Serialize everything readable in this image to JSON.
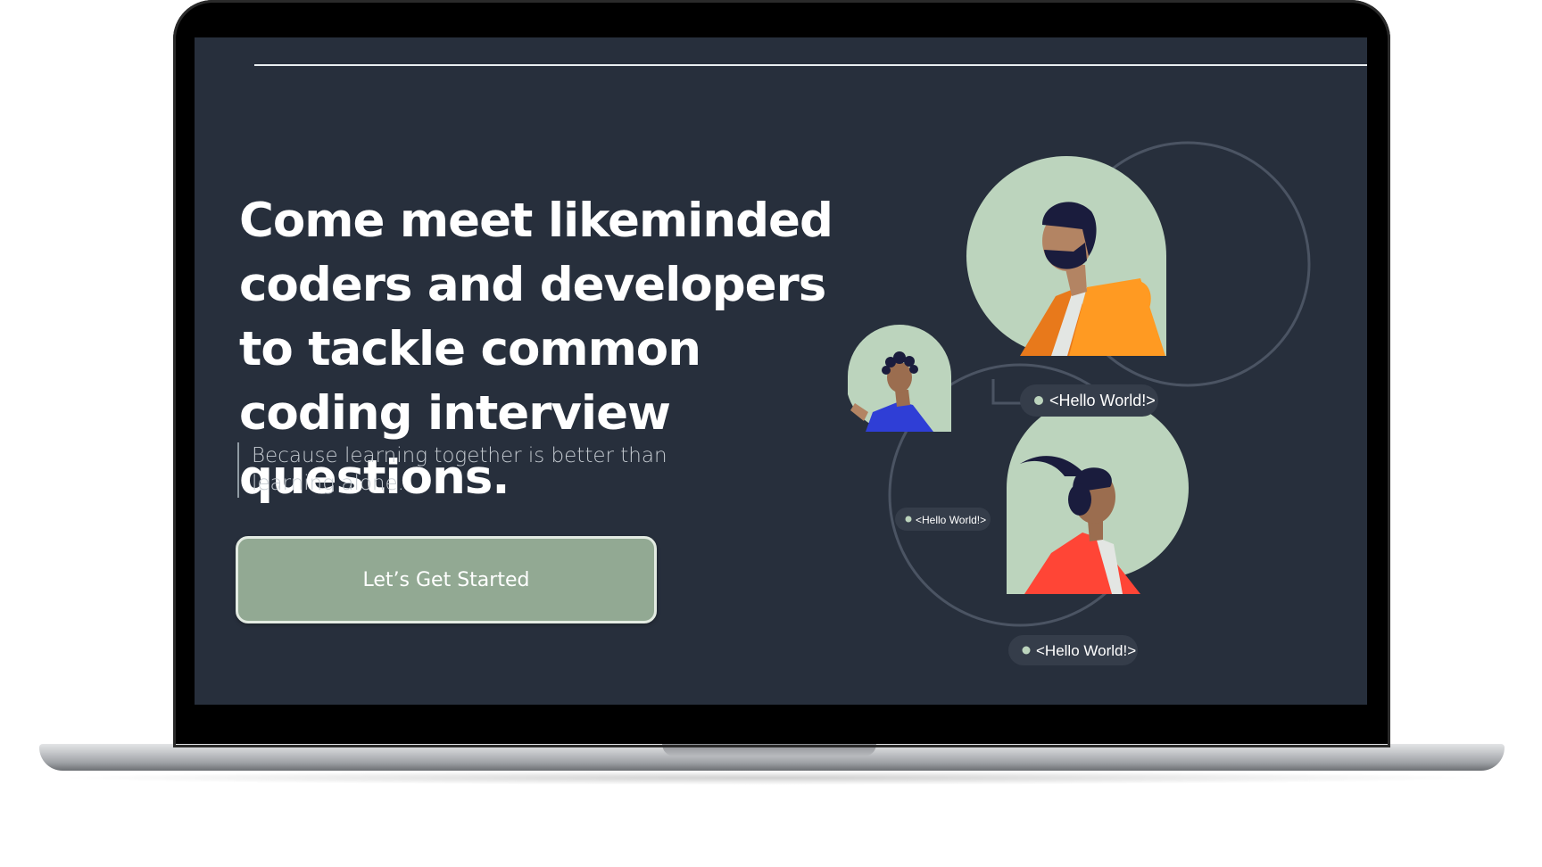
{
  "hero": {
    "headline": "Come meet likeminded coders and developers to tackle common coding interview questions.",
    "subtext": "Because learning together is better than learning alone.",
    "cta_label": "Let’s Get Started"
  },
  "illustration": {
    "bubbles": [
      {
        "text": "<Hello World!>"
      },
      {
        "text": "<Hello World!>"
      },
      {
        "text": "<Hello World!>"
      }
    ]
  },
  "colors": {
    "screen_background": "#272f3c",
    "cta_background": "#92a993",
    "avatar_background": "#bcd4bd",
    "bubble_background": "#353d4a",
    "orange_shirt": "#ff9a22",
    "blue_shirt": "#2f3ed6",
    "red_shirt": "#ff4536"
  }
}
